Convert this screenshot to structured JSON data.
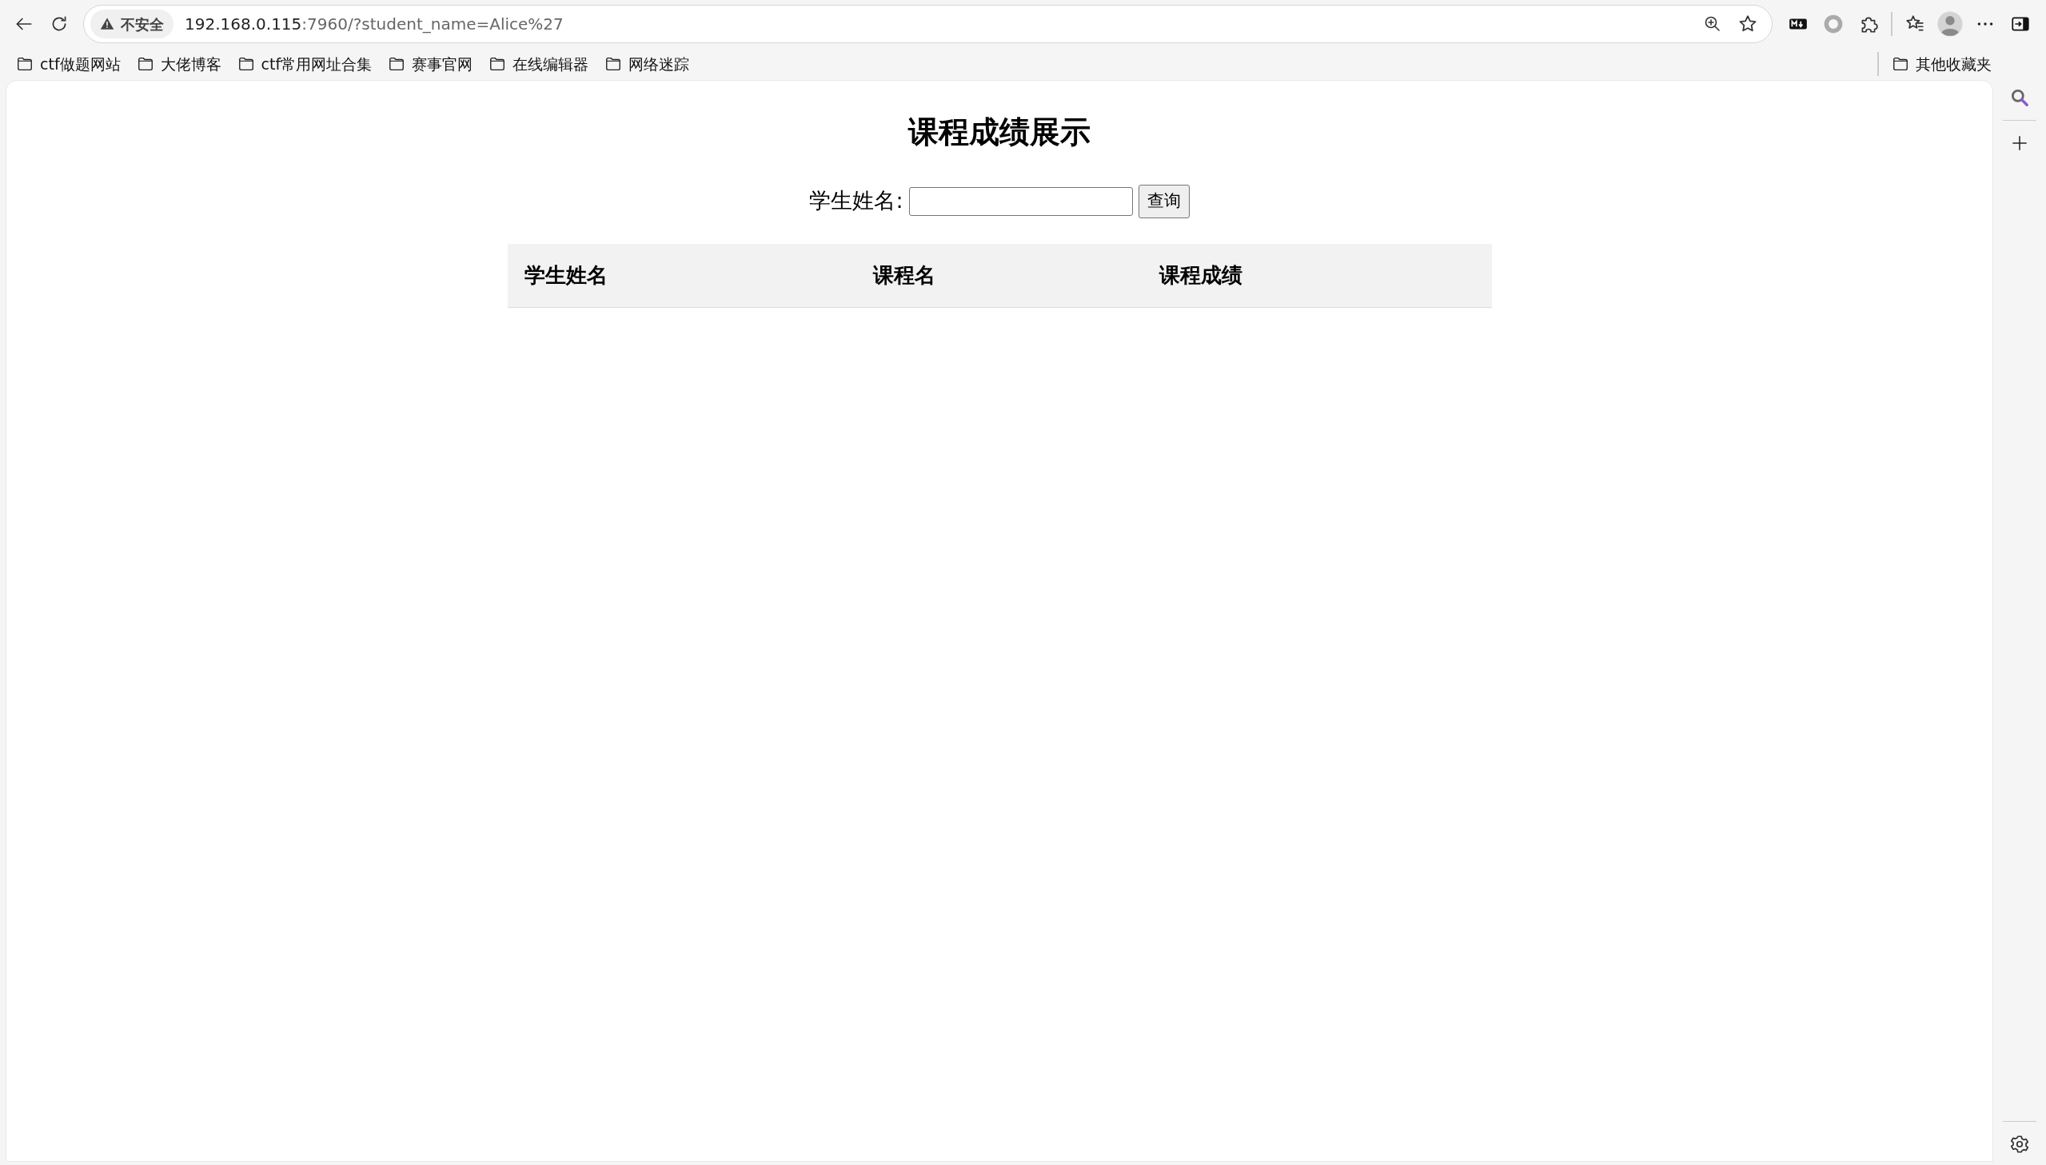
{
  "browser": {
    "security_label": "不安全",
    "url": {
      "host": "192.168.0.115",
      "rest": ":7960/?student_name=Alice%27"
    }
  },
  "bookmarks": [
    {
      "label": "ctf做题网站"
    },
    {
      "label": "大佬博客"
    },
    {
      "label": "ctf常用网址合集"
    },
    {
      "label": "赛事官网"
    },
    {
      "label": "在线编辑器"
    },
    {
      "label": "网络迷踪"
    }
  ],
  "other_bookmarks": "其他收藏夹",
  "page": {
    "title": "课程成绩展示",
    "search_label": "学生姓名:",
    "search_button": "查询",
    "table": {
      "columns": [
        "学生姓名",
        "课程名",
        "课程成绩"
      ]
    }
  }
}
